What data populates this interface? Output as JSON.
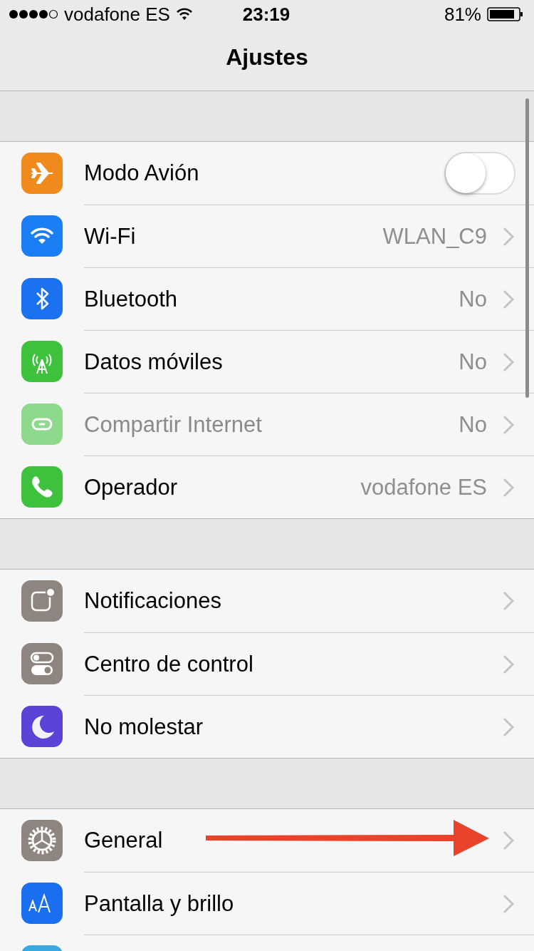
{
  "status_bar": {
    "carrier": "vodafone ES",
    "time": "23:19",
    "battery": "81%"
  },
  "nav_bar": {
    "title": "Ajustes"
  },
  "groups": [
    {
      "rows": [
        {
          "kind": "toggle",
          "label": "Modo Avión",
          "color": "#f08a1c",
          "on": false,
          "disabled": false
        },
        {
          "kind": "link",
          "label": "Wi-Fi",
          "value": "WLAN_C9",
          "color": "#1a7ef5",
          "disabled": false
        },
        {
          "kind": "link",
          "label": "Bluetooth",
          "value": "No",
          "color": "#1a72f0",
          "disabled": false
        },
        {
          "kind": "link",
          "label": "Datos móviles",
          "value": "No",
          "color": "#3ec23e",
          "disabled": false
        },
        {
          "kind": "link",
          "label": "Compartir Internet",
          "value": "No",
          "color": "#8fd98c",
          "disabled": true
        },
        {
          "kind": "link",
          "label": "Operador",
          "value": "vodafone ES",
          "color": "#3ec23e",
          "disabled": false
        }
      ]
    },
    {
      "rows": [
        {
          "kind": "link",
          "label": "Notificaciones",
          "color": "#8e8580",
          "disabled": false
        },
        {
          "kind": "link",
          "label": "Centro de control",
          "color": "#8e8580",
          "disabled": false
        },
        {
          "kind": "link",
          "label": "No molestar",
          "color": "#5a44d8",
          "disabled": false
        }
      ]
    },
    {
      "rows": [
        {
          "kind": "link",
          "label": "General",
          "color": "#8e8580",
          "disabled": false
        },
        {
          "kind": "link",
          "label": "Pantalla y brillo",
          "color": "#1a6ff0",
          "disabled": false
        },
        {
          "kind": "partial",
          "color": "#3aa8e0"
        }
      ]
    }
  ]
}
